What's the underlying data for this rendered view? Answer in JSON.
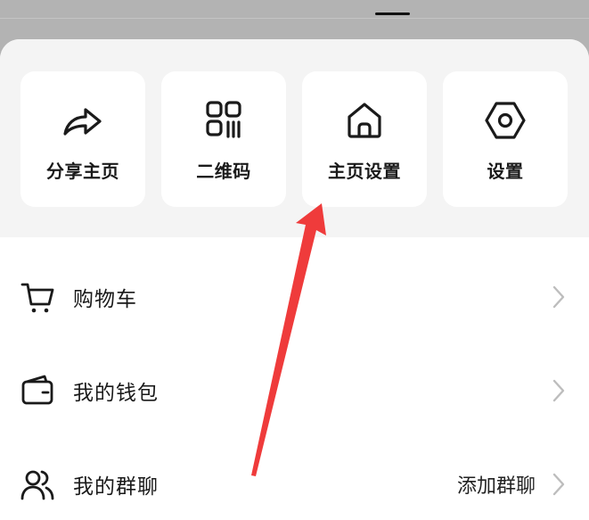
{
  "quick_actions": [
    {
      "label": "分享主页",
      "icon": "share-arrow-icon"
    },
    {
      "label": "二维码",
      "icon": "qr-code-icon"
    },
    {
      "label": "主页设置",
      "icon": "home-icon"
    },
    {
      "label": "设置",
      "icon": "gear-hexagon-icon"
    }
  ],
  "menu": [
    {
      "label": "购物车",
      "icon": "shopping-cart-icon"
    },
    {
      "label": "我的钱包",
      "icon": "wallet-icon"
    },
    {
      "label": "我的群聊",
      "icon": "group-chat-icon",
      "extra": "添加群聊"
    }
  ],
  "colors": {
    "backdrop": "#b3b3b3",
    "sheet": "#ffffff",
    "quick_area": "#f4f4f4",
    "annotation_arrow": "#ef3b3b",
    "chevron": "#bdbdbd"
  }
}
